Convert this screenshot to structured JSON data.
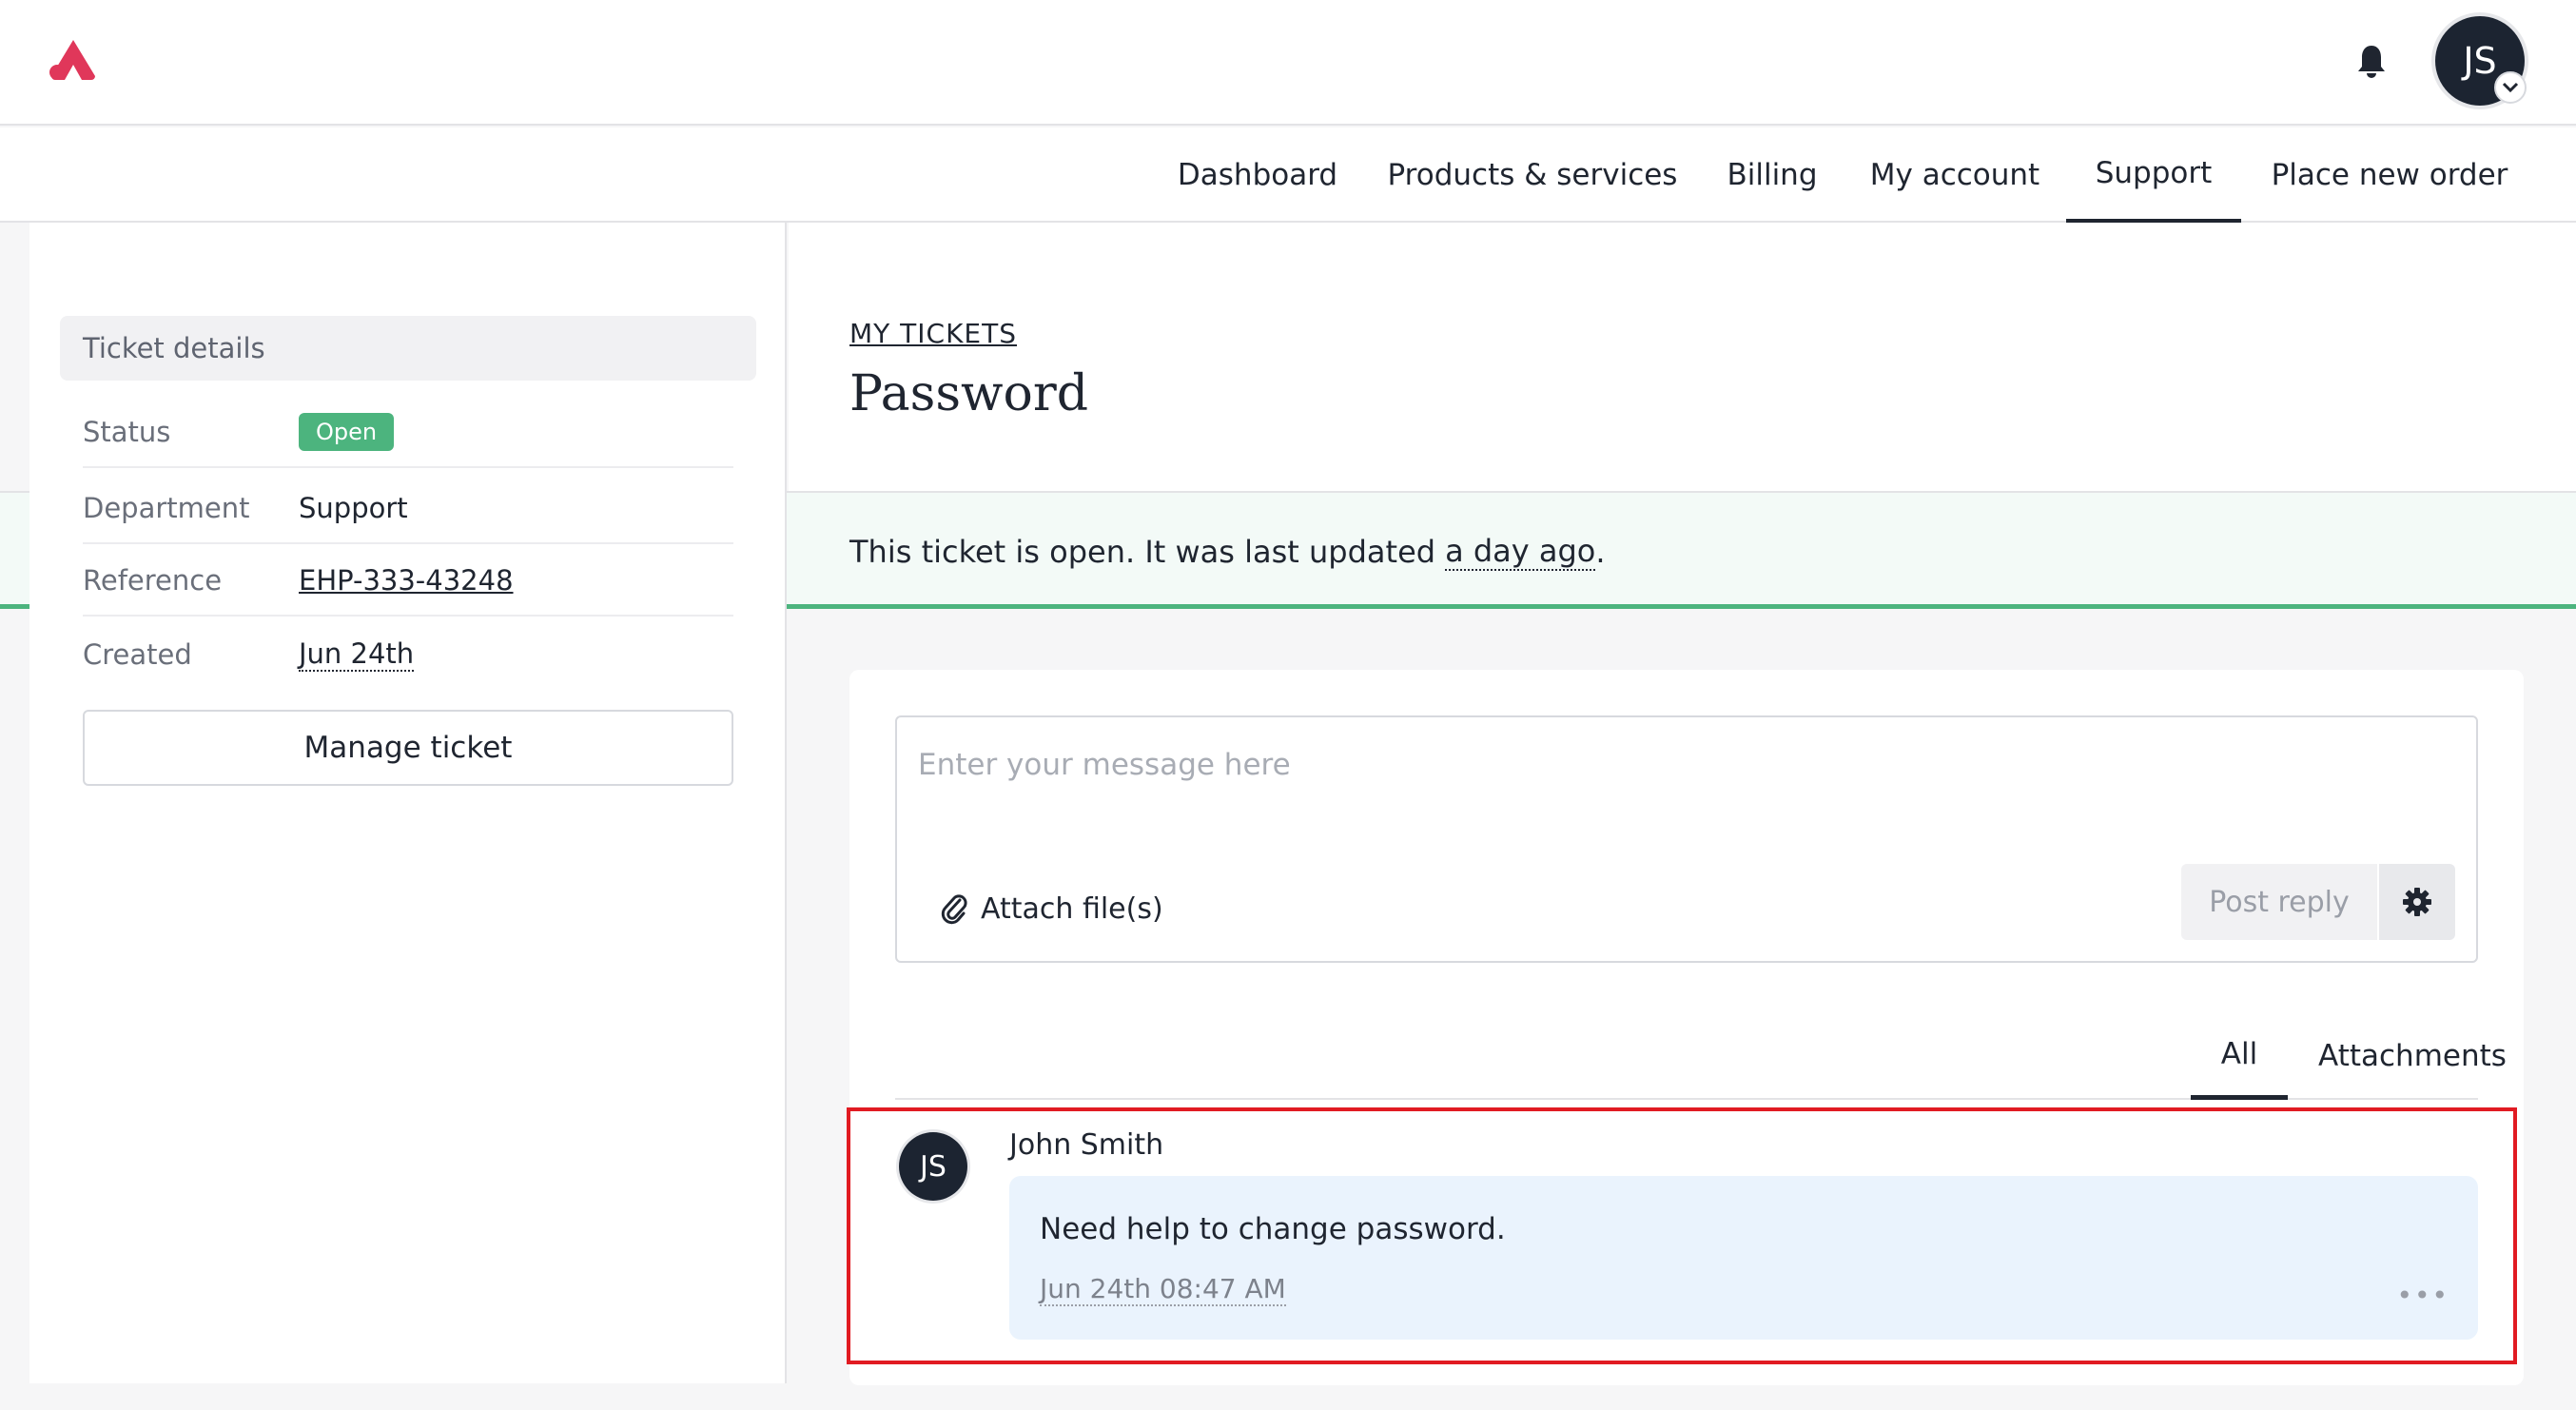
{
  "header": {
    "logo_icon": "triangle-logo-icon",
    "notification_icon": "bell-icon",
    "avatar_initials": "JS",
    "accent_color": "#e0375a"
  },
  "nav": {
    "items": [
      {
        "label": "Dashboard",
        "active": false
      },
      {
        "label": "Products & services",
        "active": false
      },
      {
        "label": "Billing",
        "active": false
      },
      {
        "label": "My account",
        "active": false
      },
      {
        "label": "Support",
        "active": true
      },
      {
        "label": "Place new order",
        "active": false
      }
    ]
  },
  "sidebar": {
    "title": "Ticket details",
    "rows": [
      {
        "label": "Status",
        "value": "Open"
      },
      {
        "label": "Department",
        "value": "Support"
      },
      {
        "label": "Reference",
        "value": "EHP-333-43248"
      },
      {
        "label": "Created",
        "value": "Jun 24th"
      }
    ],
    "status_color": "#4cb47e",
    "manage_label": "Manage ticket"
  },
  "main": {
    "breadcrumb": "MY TICKETS",
    "title": "Password",
    "banner_text": "This ticket is open. It was last updated",
    "banner_link": "a day ago",
    "banner_end": "."
  },
  "composer": {
    "placeholder": "Enter your message here",
    "attach_label": "Attach file(s)",
    "post_label": "Post reply",
    "settings_icon": "gear-icon"
  },
  "tabs": [
    {
      "label": "All",
      "active": true
    },
    {
      "label": "Attachments",
      "active": false
    }
  ],
  "messages": [
    {
      "author": "John Smith",
      "initials": "JS",
      "text": "Need help to change password.",
      "time": "Jun 24th 08:47 AM",
      "more": "•••"
    }
  ]
}
